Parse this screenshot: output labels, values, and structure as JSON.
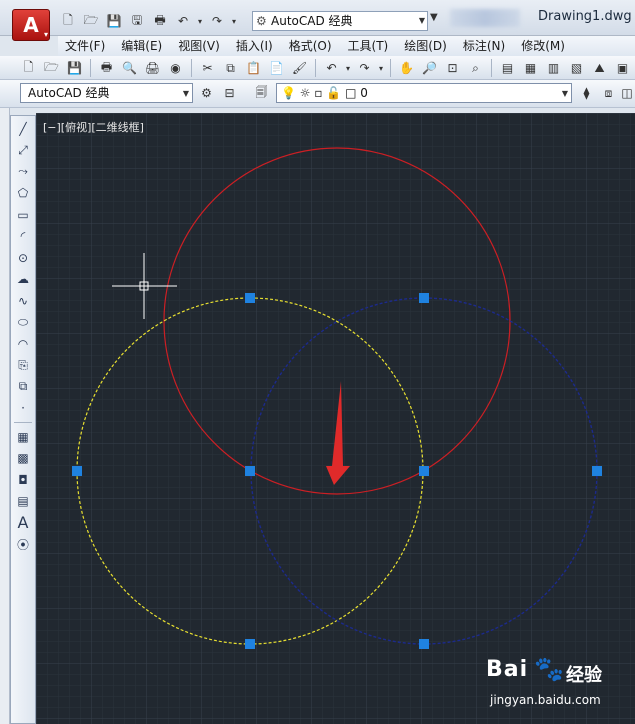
{
  "title_bar": {
    "app_button_letter": "A",
    "workspace": "AutoCAD 经典",
    "document": "Drawing1.dwg"
  },
  "menu": [
    "文件(F)",
    "编辑(E)",
    "视图(V)",
    "插入(I)",
    "格式(O)",
    "工具(T)",
    "绘图(D)",
    "标注(N)",
    "修改(M)"
  ],
  "toolbar2": {
    "workspace": "AutoCAD 经典",
    "layer": "0"
  },
  "viewport_label": "[−][俯视][二维线框]",
  "drawing": {
    "background": "#212830",
    "circles": [
      {
        "name": "red-circle",
        "color": "#cc1f24",
        "style": "solid"
      },
      {
        "name": "yellow-circle",
        "color": "#e8e030",
        "style": "dashed",
        "selected": true
      },
      {
        "name": "blue-circle",
        "color": "#1c2a8c",
        "style": "dashed",
        "selected": true
      }
    ],
    "grip_color": "#1f82e0",
    "annotation_arrow_color": "#e02a2a"
  },
  "watermark": {
    "logo": "Bai",
    "paw": "🐾",
    "text": "经验",
    "url": "jingyan.baidu.com"
  }
}
